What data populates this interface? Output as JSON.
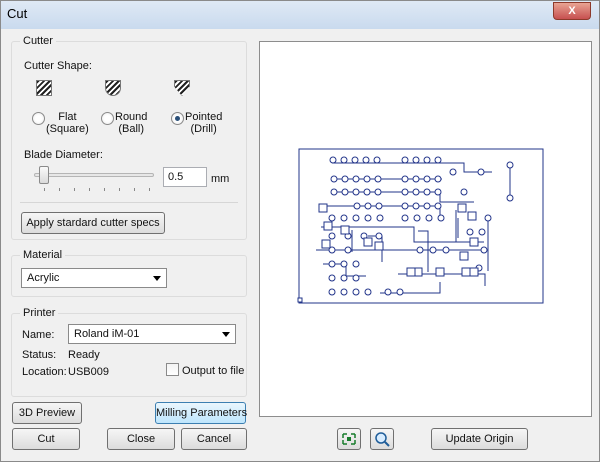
{
  "window": {
    "title": "Cut",
    "close": "X"
  },
  "cutter": {
    "group_label": "Cutter",
    "shape_label": "Cutter Shape:",
    "shapes": [
      {
        "line1": "Flat",
        "line2": "(Square)",
        "selected": false,
        "icon": "flat-cutter-icon"
      },
      {
        "line1": "Round",
        "line2": "(Ball)",
        "selected": false,
        "icon": "round-cutter-icon"
      },
      {
        "line1": "Pointed",
        "line2": "(Drill)",
        "selected": true,
        "icon": "pointed-cutter-icon"
      }
    ],
    "blade_label": "Blade Diameter:",
    "blade_value": "0.5",
    "blade_unit": "mm",
    "standard_button": "Apply stardard cutter specs"
  },
  "material": {
    "group_label": "Material",
    "value": "Acrylic"
  },
  "printer": {
    "group_label": "Printer",
    "name_label": "Name:",
    "name_value": "Roland iM-01",
    "status_label": "Status:",
    "status_value": "Ready",
    "location_label": "Location:",
    "location_value": "USB009",
    "output_to_file": "Output to file",
    "output_checked": false
  },
  "buttons": {
    "preview_3d": "3D Preview",
    "milling": "Milling Parameters",
    "cut": "Cut",
    "close": "Close",
    "cancel": "Cancel",
    "update_origin": "Update Origin"
  },
  "icons": {
    "fit": "fit-to-view-icon",
    "zoom": "zoom-icon"
  }
}
